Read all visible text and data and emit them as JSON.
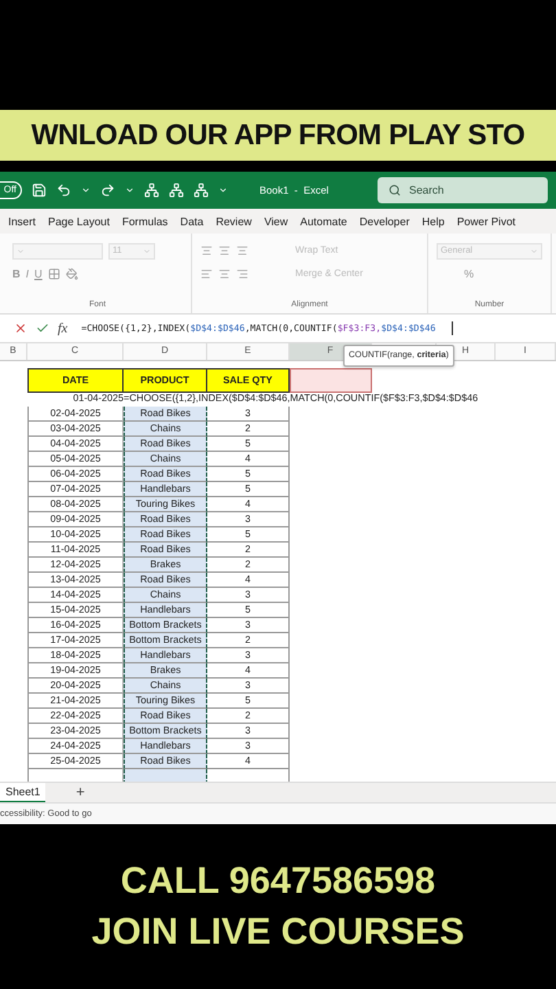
{
  "banner_top": "WNLOAD OUR APP FROM PLAY STO",
  "title_bar": {
    "autosave": "Off",
    "title": "Book1  -  Excel",
    "search": {
      "placeholder": "Search"
    }
  },
  "menu_tabs": [
    "Insert",
    "Page Layout",
    "Formulas",
    "Data",
    "Review",
    "View",
    "Automate",
    "Developer",
    "Help",
    "Power Pivot"
  ],
  "ribbon": {
    "font_size": "11",
    "bold": "B",
    "italic": "I",
    "underline": "U",
    "wrap_text": "Wrap Text",
    "merge_center": "Merge & Center",
    "number_format": "General",
    "percent": "%",
    "groups": [
      "Font",
      "Alignment",
      "Number"
    ]
  },
  "formula_bar": {
    "fx": "fx",
    "parts": [
      {
        "text": "=CHOOSE({1,2},INDEX(",
        "kind": "plain"
      },
      {
        "text": "$D$4:$D$46",
        "kind": "ref"
      },
      {
        "text": ",MATCH(0,COUNTIF(",
        "kind": "plain"
      },
      {
        "text": "$F$3:F3,",
        "kind": "ref2"
      },
      {
        "text": "$D$4:$D$46",
        "kind": "ref"
      }
    ]
  },
  "columns": [
    "B",
    "C",
    "D",
    "E",
    "F",
    "H",
    "I"
  ],
  "tooltip": "COUNTIF(range, **criteria**)",
  "table": {
    "headers": [
      "DATE",
      "PRODUCT",
      "SALE QTY"
    ],
    "edit_row": {
      "date": "01-04-2025",
      "formula": "=CHOOSE({1,2},INDEX($D$4:$D$46,MATCH(0,COUNTIF($F$3:F3,$D$4:$D$46"
    },
    "rows": [
      [
        "02-04-2025",
        "Road Bikes",
        "3"
      ],
      [
        "03-04-2025",
        "Chains",
        "2"
      ],
      [
        "04-04-2025",
        "Road Bikes",
        "5"
      ],
      [
        "05-04-2025",
        "Chains",
        "4"
      ],
      [
        "06-04-2025",
        "Road Bikes",
        "5"
      ],
      [
        "07-04-2025",
        "Handlebars",
        "5"
      ],
      [
        "08-04-2025",
        "Touring Bikes",
        "4"
      ],
      [
        "09-04-2025",
        "Road Bikes",
        "3"
      ],
      [
        "10-04-2025",
        "Road Bikes",
        "5"
      ],
      [
        "11-04-2025",
        "Road Bikes",
        "2"
      ],
      [
        "12-04-2025",
        "Brakes",
        "2"
      ],
      [
        "13-04-2025",
        "Road Bikes",
        "4"
      ],
      [
        "14-04-2025",
        "Chains",
        "3"
      ],
      [
        "15-04-2025",
        "Handlebars",
        "5"
      ],
      [
        "16-04-2025",
        "Bottom Brackets",
        "3"
      ],
      [
        "17-04-2025",
        "Bottom Brackets",
        "2"
      ],
      [
        "18-04-2025",
        "Handlebars",
        "3"
      ],
      [
        "19-04-2025",
        "Brakes",
        "4"
      ],
      [
        "20-04-2025",
        "Chains",
        "3"
      ],
      [
        "21-04-2025",
        "Touring Bikes",
        "5"
      ],
      [
        "22-04-2025",
        "Road Bikes",
        "2"
      ],
      [
        "23-04-2025",
        "Bottom Brackets",
        "3"
      ],
      [
        "24-04-2025",
        "Handlebars",
        "3"
      ],
      [
        "25-04-2025",
        "Road Bikes",
        "4"
      ]
    ]
  },
  "sheet_tabs": [
    {
      "label": "Sheet1",
      "selected": true
    }
  ],
  "add_sheet": "+",
  "status": "ccessibility: Good to go",
  "banner_bottom": [
    "CALL 9647586598",
    "JOIN LIVE COURSES"
  ]
}
